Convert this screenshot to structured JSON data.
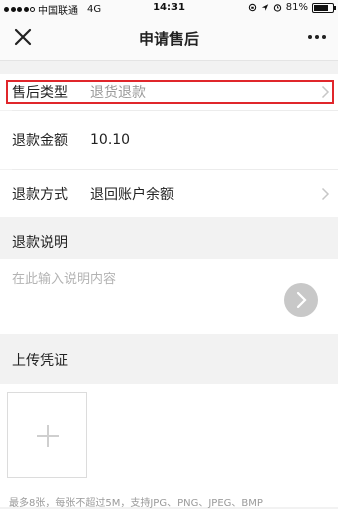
{
  "status_bar": {
    "carrier": "中国联通",
    "network": "4G",
    "time": "14:31",
    "battery": "81%",
    "battery_level": 0.81
  },
  "navbar": {
    "title": "申请售后"
  },
  "form": {
    "after_sale_type": {
      "label": "售后类型",
      "value": "退货退款"
    },
    "refund_amount": {
      "label": "退款金额",
      "value": "10.10"
    },
    "refund_method": {
      "label": "退款方式",
      "value": "退回账户余额"
    }
  },
  "refund_note": {
    "header": "退款说明",
    "placeholder": "在此输入说明内容"
  },
  "upload": {
    "header": "上传凭证",
    "hint": "最多8张，每张不超过5M，支持JPG、PNG、JPEG、BMP"
  },
  "colors": {
    "highlight": "#e0262b",
    "background": "#f2f2f2"
  }
}
